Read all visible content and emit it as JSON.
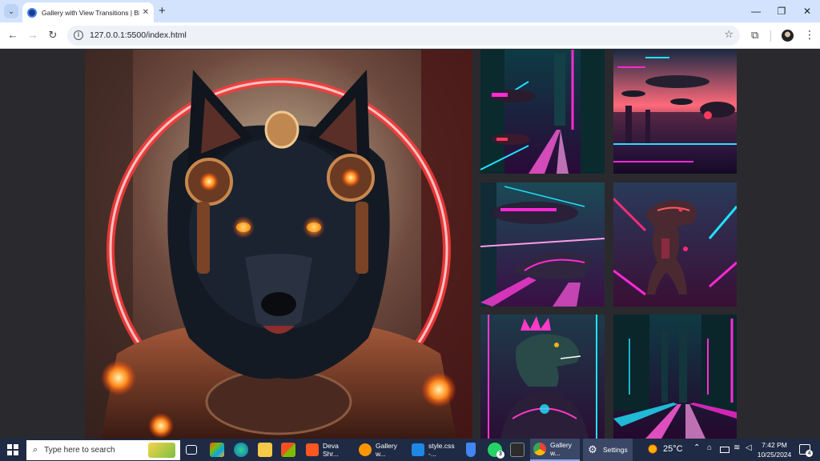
{
  "browser": {
    "tab_title": "Gallery with View Transitions | Blu",
    "tab_close": "✕",
    "new_tab": "+",
    "url": "127.0.0.1:5500/index.html",
    "window_controls": {
      "minimize": "—",
      "restore": "❐",
      "close": "✕"
    }
  },
  "gallery": {
    "hero": {
      "subject": "cyberpunk wolf in armor",
      "accent": "#ff2a3b"
    },
    "thumbs": [
      {
        "subject": "neon city flying cars",
        "accent": "#ff2ad4"
      },
      {
        "subject": "sunset skyline airships",
        "accent": "#ff3b8c"
      },
      {
        "subject": "neon blimp and hover car",
        "accent": "#ff2ad4"
      },
      {
        "subject": "neon t-rex in armor",
        "accent": "#ff2a7a"
      },
      {
        "subject": "punk lizard portrait",
        "accent": "#ff39c8"
      },
      {
        "subject": "neon city highway",
        "accent": "#ff2ad4"
      }
    ]
  },
  "taskbar": {
    "search_placeholder": "Type here to search",
    "apps": [
      {
        "label": "Deva Shr...",
        "color": "#ff5722"
      },
      {
        "label": "Gallery w...",
        "color": "#ff9500"
      },
      {
        "label": "style.css -...",
        "color": "#1e88e5"
      },
      {
        "label": "Gallery w...",
        "color": "#ea4335"
      },
      {
        "label": "Settings",
        "color": "#9aa0a6"
      }
    ],
    "whatsapp_badge": "3",
    "temperature": "25°C",
    "time": "7:42 PM",
    "date": "10/25/2024",
    "notification_count": "4"
  }
}
